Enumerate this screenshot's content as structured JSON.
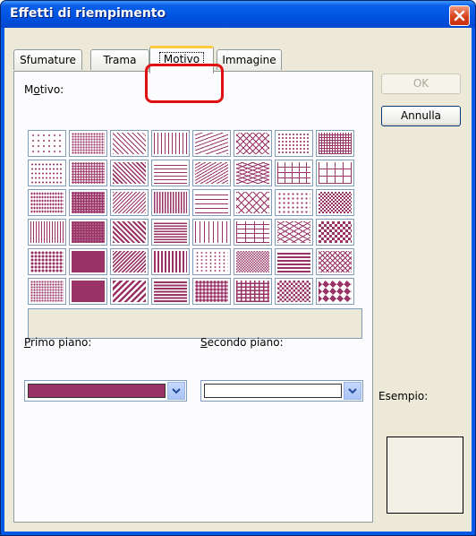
{
  "window": {
    "title": "Effetti di riempimento"
  },
  "tabs": [
    {
      "label": "Sfumature",
      "active": false
    },
    {
      "label": "Trama",
      "active": false
    },
    {
      "label": "Motivo",
      "active": true
    },
    {
      "label": "Immagine",
      "active": false
    }
  ],
  "pattern_section": {
    "label": "Motivo:",
    "pattern_count": 48,
    "selected_pattern_name": ""
  },
  "foreground": {
    "label": "Primo piano:",
    "color": "#993366"
  },
  "background": {
    "label": "Secondo piano:",
    "color": "#ffffff"
  },
  "buttons": {
    "ok_label": "OK",
    "ok_enabled": false,
    "cancel_label": "Annulla"
  },
  "preview": {
    "label": "Esempio:"
  },
  "colors": {
    "pattern": "#993366",
    "highlight": "#e01010"
  }
}
